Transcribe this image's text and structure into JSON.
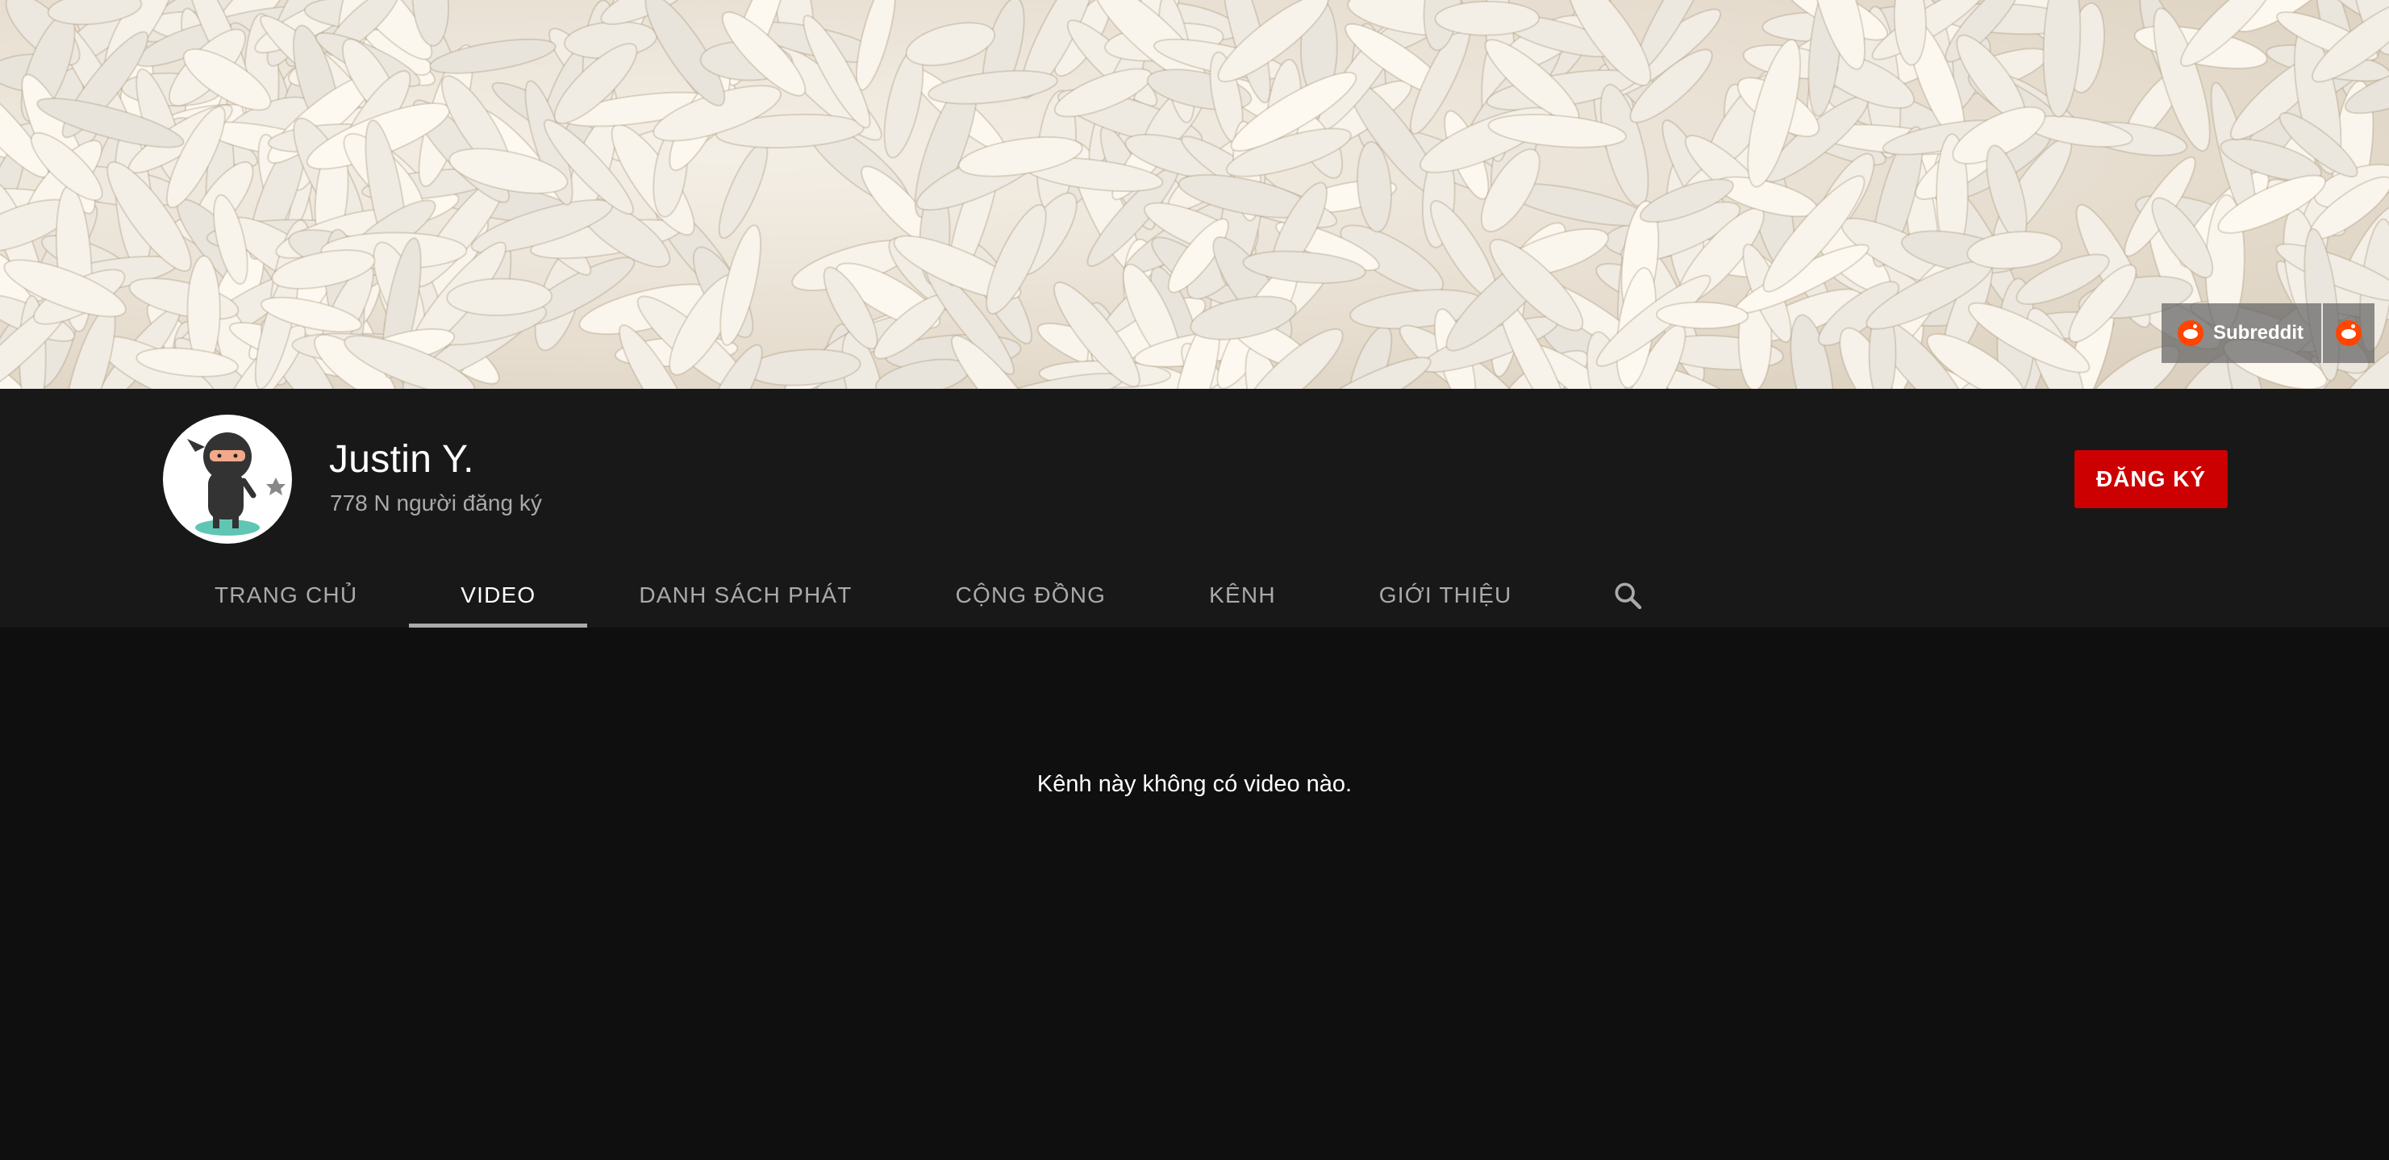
{
  "banner": {
    "links": [
      {
        "label": "Subreddit",
        "icon": "reddit-icon"
      },
      {
        "label": "",
        "icon": "reddit-icon"
      }
    ]
  },
  "channel": {
    "name": "Justin Y.",
    "subscribers": "778 N người đăng ký",
    "avatar_icon": "ninja-avatar"
  },
  "subscribe": {
    "label": "ĐĂNG KÝ",
    "color": "#cc0000"
  },
  "tabs": [
    {
      "label": "TRANG CHỦ",
      "active": false
    },
    {
      "label": "VIDEO",
      "active": true
    },
    {
      "label": "DANH SÁCH PHÁT",
      "active": false
    },
    {
      "label": "CỘNG ĐỒNG",
      "active": false
    },
    {
      "label": "KÊNH",
      "active": false
    },
    {
      "label": "GIỚI THIỆU",
      "active": false
    }
  ],
  "search_icon": "search-icon",
  "content": {
    "empty_message": "Kênh này không có video nào."
  }
}
